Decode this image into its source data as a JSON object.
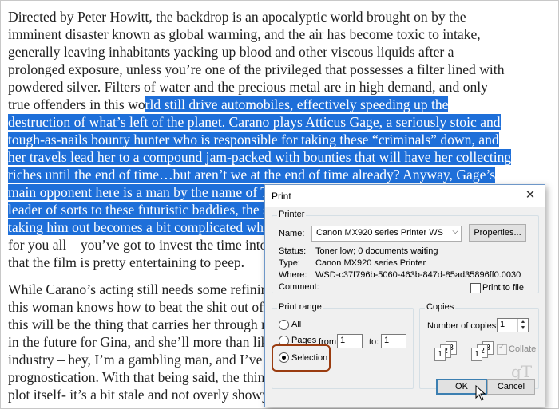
{
  "article": {
    "lines": [
      {
        "plain": "Directed by Peter Howitt, the backdrop is an apocalyptic world brought on by the",
        "sel": "",
        "after": ""
      },
      {
        "plain": "imminent disaster known as global warming, and the air has become toxic to intake,",
        "sel": "",
        "after": ""
      },
      {
        "plain": "generally leaving inhabitants yacking up blood and other viscous liquids after a",
        "sel": "",
        "after": ""
      },
      {
        "plain": "prolonged exposure, unless you’re one of the privileged that possesses a filter lined with",
        "sel": "",
        "after": ""
      },
      {
        "plain": "powdered silver. Filters of water and the precious metal are in high demand, and only",
        "sel": "",
        "after": ""
      },
      {
        "plain": "true offenders in this wo",
        "sel": "rld still drive automobiles, effectively speeding up the",
        "after": ""
      },
      {
        "plain": "",
        "sel": "destruction of what’s left of the planet. Carano plays Atticus Gage, a seriously stoic and",
        "after": ""
      },
      {
        "plain": "",
        "sel": "tough-as-nails bounty hunter who is responsible for taking these “criminals” down, and",
        "after": ""
      },
      {
        "plain": "",
        "sel": "her travels lead her to a compound jam-packed with bounties that will have her collecting",
        "after": ""
      },
      {
        "plain": "",
        "sel": "riches until the end of time…but aren’t we at the end of time already? Anyway, Gage’s",
        "after": ""
      },
      {
        "plain": "",
        "sel": "main opponent here is a man by the name of Thon",
        "after": ""
      },
      {
        "plain": "",
        "sel": "leader of sorts to these futuristic baddies, the situa",
        "after": ""
      },
      {
        "plain": "",
        "sel": "taking him out becomes a bit complicated when",
        "after": "…c"
      },
      {
        "plain": "for you all – you’ve got to invest the time into it ju",
        "sel": "",
        "after": ""
      },
      {
        "plain": "that the film is pretty entertaining to peep.",
        "sel": "",
        "after": ""
      },
      {
        "plain": "While Carano’s acting still needs some refining, let",
        "sel": "",
        "after": ""
      },
      {
        "plain": "this woman knows how to beat the shit out of peop",
        "sel": "",
        "after": ""
      },
      {
        "plain": "this will be the thing that carries her through many",
        "sel": "",
        "after": ""
      },
      {
        "plain": "in the future for Gina, and she’ll more than likely t",
        "sel": "",
        "after": ""
      },
      {
        "plain": "industry – hey, I’m a gambling man, and I’ve done",
        "sel": "",
        "after": ""
      },
      {
        "plain": "prognostication. With that being said, the thing th",
        "sel": "",
        "after": ""
      },
      {
        "plain": "plot itself- it’s a bit stale and not overly showy, and which I look for a villain to oppose the",
        "sel": "",
        "after": ""
      }
    ]
  },
  "dialog": {
    "title": "Print",
    "close_glyph": "✕",
    "printer": {
      "group_label": "Printer",
      "name_label": "Name:",
      "name_value": "Canon MX920 series Printer WS",
      "properties_label": "Properties...",
      "status_label": "Status:",
      "status_value": "Toner low; 0 documents waiting",
      "type_label": "Type:",
      "type_value": "Canon MX920 series Printer",
      "where_label": "Where:",
      "where_value": "WSD-c37f796b-5060-463b-847d-85ad35896ff0.0030",
      "comment_label": "Comment:",
      "print_to_file_label": "Print to file"
    },
    "print_range": {
      "group_label": "Print range",
      "all_label": "All",
      "pages_label": "Pages",
      "from_label": "from:",
      "from_value": "1",
      "to_label": "to:",
      "to_value": "1",
      "selection_label": "Selection"
    },
    "copies": {
      "group_label": "Copies",
      "number_label": "Number of copies:",
      "number_value": "1",
      "collate_label": "Collate"
    },
    "ok_label": "OK",
    "cancel_label": "Cancel"
  },
  "colors": {
    "selection": "#1e6fd9",
    "highlight_ring": "#9a3c10"
  },
  "watermark": "gT"
}
